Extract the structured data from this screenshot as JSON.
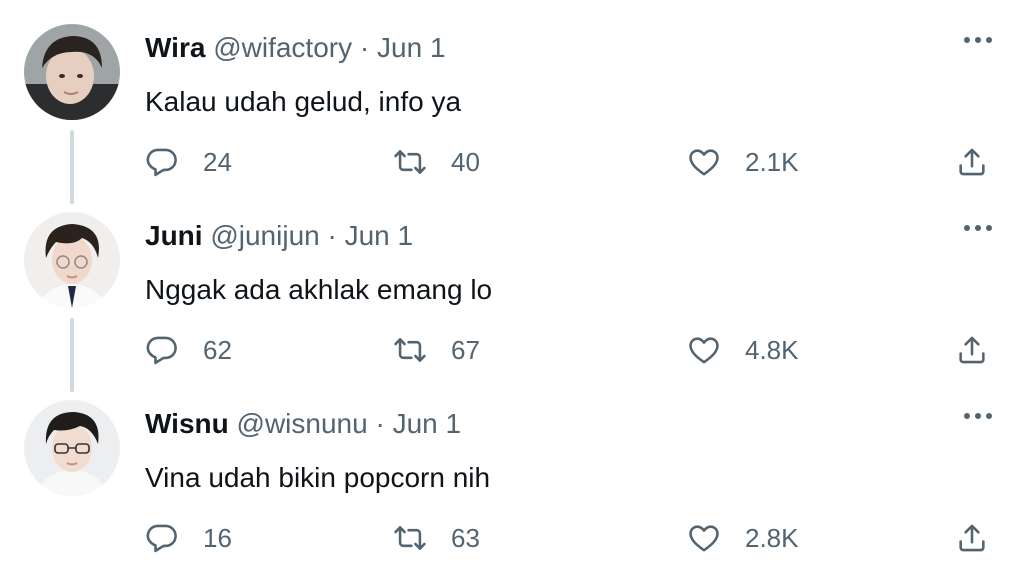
{
  "theme": {
    "text": "#0f1419",
    "secondary": "#536471",
    "thread_line": "#cfd9de"
  },
  "tweets": [
    {
      "name": "Wira",
      "handle": "@wifactory",
      "separator": "·",
      "date": "Jun 1",
      "text": "Kalau udah gelud, info ya",
      "replies": "24",
      "retweets": "40",
      "likes": "2.1K"
    },
    {
      "name": "Juni",
      "handle": "@junijun",
      "separator": "·",
      "date": "Jun 1",
      "text": "Nggak ada akhlak emang lo",
      "replies": "62",
      "retweets": "67",
      "likes": "4.8K"
    },
    {
      "name": "Wisnu",
      "handle": "@wisnunu",
      "separator": "·",
      "date": "Jun 1",
      "text": "Vina udah bikin popcorn nih",
      "replies": "16",
      "retweets": "63",
      "likes": "2.8K"
    }
  ],
  "icons": {
    "reply": "reply-icon",
    "retweet": "retweet-icon",
    "like": "heart-icon",
    "share": "share-icon",
    "more": "more-icon"
  }
}
